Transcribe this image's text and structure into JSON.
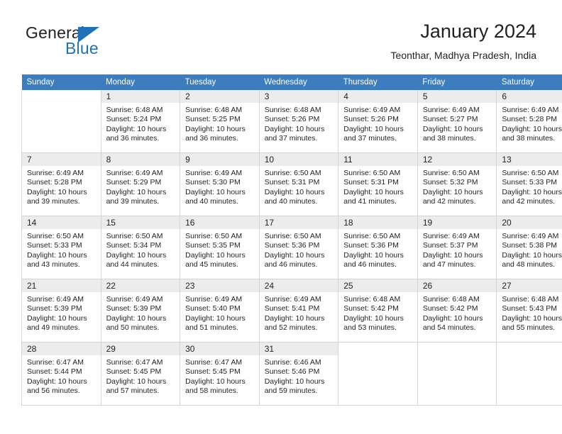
{
  "logo": {
    "word_top": "General",
    "word_bottom": "Blue",
    "accent_color": "#1f72b8"
  },
  "header": {
    "title": "January 2024",
    "subtitle": "Teonthar, Madhya Pradesh, India",
    "header_bg_color": "#3b7dbf"
  },
  "calendar": {
    "weekday_headers": [
      "Sunday",
      "Monday",
      "Tuesday",
      "Wednesday",
      "Thursday",
      "Friday",
      "Saturday"
    ],
    "weeks": [
      [
        {
          "day": "",
          "lines": []
        },
        {
          "day": "1",
          "lines": [
            "Sunrise: 6:48 AM",
            "Sunset: 5:24 PM",
            "Daylight: 10 hours",
            "and 36 minutes."
          ]
        },
        {
          "day": "2",
          "lines": [
            "Sunrise: 6:48 AM",
            "Sunset: 5:25 PM",
            "Daylight: 10 hours",
            "and 36 minutes."
          ]
        },
        {
          "day": "3",
          "lines": [
            "Sunrise: 6:48 AM",
            "Sunset: 5:26 PM",
            "Daylight: 10 hours",
            "and 37 minutes."
          ]
        },
        {
          "day": "4",
          "lines": [
            "Sunrise: 6:49 AM",
            "Sunset: 5:26 PM",
            "Daylight: 10 hours",
            "and 37 minutes."
          ]
        },
        {
          "day": "5",
          "lines": [
            "Sunrise: 6:49 AM",
            "Sunset: 5:27 PM",
            "Daylight: 10 hours",
            "and 38 minutes."
          ]
        },
        {
          "day": "6",
          "lines": [
            "Sunrise: 6:49 AM",
            "Sunset: 5:28 PM",
            "Daylight: 10 hours",
            "and 38 minutes."
          ]
        }
      ],
      [
        {
          "day": "7",
          "lines": [
            "Sunrise: 6:49 AM",
            "Sunset: 5:28 PM",
            "Daylight: 10 hours",
            "and 39 minutes."
          ]
        },
        {
          "day": "8",
          "lines": [
            "Sunrise: 6:49 AM",
            "Sunset: 5:29 PM",
            "Daylight: 10 hours",
            "and 39 minutes."
          ]
        },
        {
          "day": "9",
          "lines": [
            "Sunrise: 6:49 AM",
            "Sunset: 5:30 PM",
            "Daylight: 10 hours",
            "and 40 minutes."
          ]
        },
        {
          "day": "10",
          "lines": [
            "Sunrise: 6:50 AM",
            "Sunset: 5:31 PM",
            "Daylight: 10 hours",
            "and 40 minutes."
          ]
        },
        {
          "day": "11",
          "lines": [
            "Sunrise: 6:50 AM",
            "Sunset: 5:31 PM",
            "Daylight: 10 hours",
            "and 41 minutes."
          ]
        },
        {
          "day": "12",
          "lines": [
            "Sunrise: 6:50 AM",
            "Sunset: 5:32 PM",
            "Daylight: 10 hours",
            "and 42 minutes."
          ]
        },
        {
          "day": "13",
          "lines": [
            "Sunrise: 6:50 AM",
            "Sunset: 5:33 PM",
            "Daylight: 10 hours",
            "and 42 minutes."
          ]
        }
      ],
      [
        {
          "day": "14",
          "lines": [
            "Sunrise: 6:50 AM",
            "Sunset: 5:33 PM",
            "Daylight: 10 hours",
            "and 43 minutes."
          ]
        },
        {
          "day": "15",
          "lines": [
            "Sunrise: 6:50 AM",
            "Sunset: 5:34 PM",
            "Daylight: 10 hours",
            "and 44 minutes."
          ]
        },
        {
          "day": "16",
          "lines": [
            "Sunrise: 6:50 AM",
            "Sunset: 5:35 PM",
            "Daylight: 10 hours",
            "and 45 minutes."
          ]
        },
        {
          "day": "17",
          "lines": [
            "Sunrise: 6:50 AM",
            "Sunset: 5:36 PM",
            "Daylight: 10 hours",
            "and 46 minutes."
          ]
        },
        {
          "day": "18",
          "lines": [
            "Sunrise: 6:50 AM",
            "Sunset: 5:36 PM",
            "Daylight: 10 hours",
            "and 46 minutes."
          ]
        },
        {
          "day": "19",
          "lines": [
            "Sunrise: 6:49 AM",
            "Sunset: 5:37 PM",
            "Daylight: 10 hours",
            "and 47 minutes."
          ]
        },
        {
          "day": "20",
          "lines": [
            "Sunrise: 6:49 AM",
            "Sunset: 5:38 PM",
            "Daylight: 10 hours",
            "and 48 minutes."
          ]
        }
      ],
      [
        {
          "day": "21",
          "lines": [
            "Sunrise: 6:49 AM",
            "Sunset: 5:39 PM",
            "Daylight: 10 hours",
            "and 49 minutes."
          ]
        },
        {
          "day": "22",
          "lines": [
            "Sunrise: 6:49 AM",
            "Sunset: 5:39 PM",
            "Daylight: 10 hours",
            "and 50 minutes."
          ]
        },
        {
          "day": "23",
          "lines": [
            "Sunrise: 6:49 AM",
            "Sunset: 5:40 PM",
            "Daylight: 10 hours",
            "and 51 minutes."
          ]
        },
        {
          "day": "24",
          "lines": [
            "Sunrise: 6:49 AM",
            "Sunset: 5:41 PM",
            "Daylight: 10 hours",
            "and 52 minutes."
          ]
        },
        {
          "day": "25",
          "lines": [
            "Sunrise: 6:48 AM",
            "Sunset: 5:42 PM",
            "Daylight: 10 hours",
            "and 53 minutes."
          ]
        },
        {
          "day": "26",
          "lines": [
            "Sunrise: 6:48 AM",
            "Sunset: 5:42 PM",
            "Daylight: 10 hours",
            "and 54 minutes."
          ]
        },
        {
          "day": "27",
          "lines": [
            "Sunrise: 6:48 AM",
            "Sunset: 5:43 PM",
            "Daylight: 10 hours",
            "and 55 minutes."
          ]
        }
      ],
      [
        {
          "day": "28",
          "lines": [
            "Sunrise: 6:47 AM",
            "Sunset: 5:44 PM",
            "Daylight: 10 hours",
            "and 56 minutes."
          ]
        },
        {
          "day": "29",
          "lines": [
            "Sunrise: 6:47 AM",
            "Sunset: 5:45 PM",
            "Daylight: 10 hours",
            "and 57 minutes."
          ]
        },
        {
          "day": "30",
          "lines": [
            "Sunrise: 6:47 AM",
            "Sunset: 5:45 PM",
            "Daylight: 10 hours",
            "and 58 minutes."
          ]
        },
        {
          "day": "31",
          "lines": [
            "Sunrise: 6:46 AM",
            "Sunset: 5:46 PM",
            "Daylight: 10 hours",
            "and 59 minutes."
          ]
        },
        {
          "day": "",
          "lines": []
        },
        {
          "day": "",
          "lines": []
        },
        {
          "day": "",
          "lines": []
        }
      ]
    ]
  }
}
